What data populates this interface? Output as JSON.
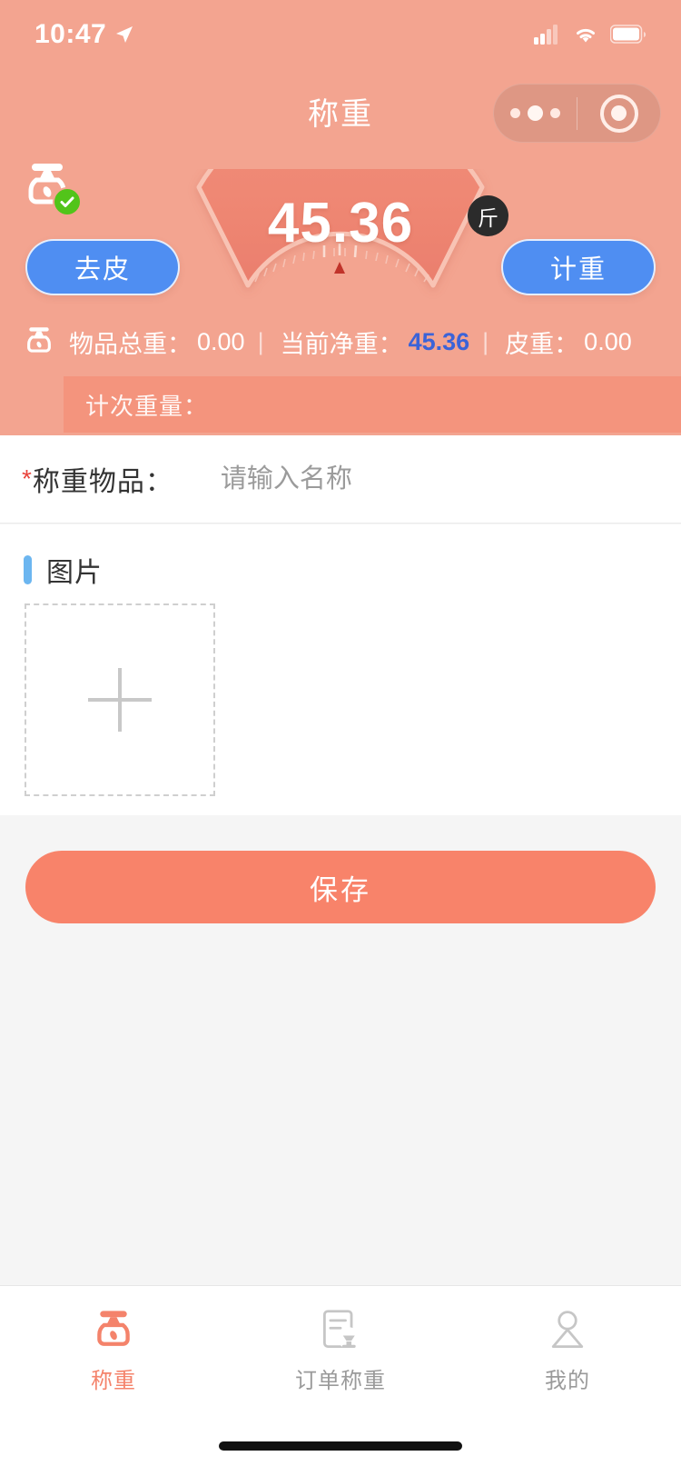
{
  "statusbar": {
    "time": "10:47",
    "location_icon": "location-arrow-icon",
    "signal_icon": "cellular-signal-icon",
    "wifi_icon": "wifi-icon",
    "battery_icon": "battery-icon"
  },
  "navbar": {
    "title": "称重",
    "capsule": {
      "menu_icon": "more-dots-icon",
      "target_icon": "target-circle-icon"
    }
  },
  "device": {
    "status_icon": "scale-icon",
    "connected_icon": "check-circle-icon",
    "connected": true
  },
  "gauge": {
    "value": "45.36",
    "unit": "斤",
    "pointer_icon": "gauge-pointer-icon"
  },
  "actions": {
    "tare_label": "去皮",
    "count_label": "计重"
  },
  "readouts": {
    "icon": "scale-icon",
    "separator": "|",
    "items": [
      {
        "label": "物品总重：",
        "value": "0.00",
        "highlight": false
      },
      {
        "label": "当前净重：",
        "value": "45.36",
        "highlight": true
      },
      {
        "label": "皮重：",
        "value": "0.00",
        "highlight": false
      }
    ],
    "count_weight_label": "计次重量：",
    "count_weight_value": ""
  },
  "form": {
    "required_mark": "*",
    "item_label": "称重物品：",
    "item_value": "",
    "item_placeholder": "请输入名称"
  },
  "images": {
    "section_title": "图片",
    "add_icon": "plus-icon"
  },
  "footer": {
    "save_label": "保存"
  },
  "tabbar": {
    "items": [
      {
        "label": "称重",
        "icon": "scale-icon",
        "active": true
      },
      {
        "label": "订单称重",
        "icon": "order-scale-icon",
        "active": false
      },
      {
        "label": "我的",
        "icon": "user-icon",
        "active": false
      }
    ]
  },
  "colors": {
    "header_pink": "#f3a490",
    "accent_coral": "#f8836a",
    "button_blue": "#4f8ef2",
    "net_weight_blue": "#3b63d8",
    "check_green": "#52c41a",
    "section_bar_blue": "#6cb6f0"
  }
}
